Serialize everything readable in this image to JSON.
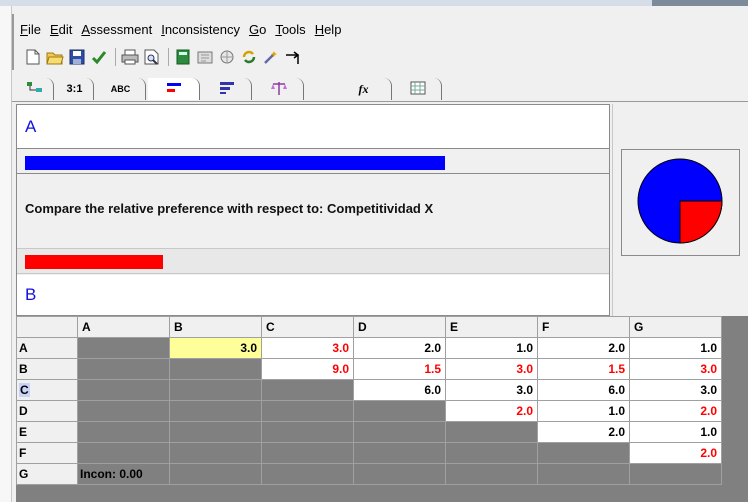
{
  "menu": [
    "File",
    "Edit",
    "Assessment",
    "Inconsistency",
    "Go",
    "Tools",
    "Help"
  ],
  "menu_underline": [
    "F",
    "E",
    "A",
    "I",
    "G",
    "T",
    "H"
  ],
  "toolbar_icons": [
    "new-icon",
    "open-icon",
    "save-icon",
    "check-icon",
    "print-icon",
    "print-preview-icon",
    "calculator-icon",
    "sheet-icon",
    "sensitivity-icon",
    "refresh-icon",
    "wand-icon",
    "arrow-right-icon"
  ],
  "tabs": [
    {
      "icon": "tree-icon",
      "label": ""
    },
    {
      "icon": "ratio-icon",
      "label": "3:1"
    },
    {
      "icon": "abc-icon",
      "label": "ABC"
    },
    {
      "icon": "bars-icon",
      "label": ""
    },
    {
      "icon": "bars-blue-icon",
      "label": ""
    },
    {
      "icon": "scale-icon",
      "label": ""
    },
    {
      "icon": "formula-icon",
      "label": "fx"
    },
    {
      "icon": "grid-icon",
      "label": ""
    }
  ],
  "compare": {
    "item_a": "A",
    "item_b": "B",
    "question": "Compare the relative preference with respect to: Competitividad X",
    "bar_a_fraction": 0.73,
    "bar_b_fraction": 0.24,
    "bar_a_color": "#0000ff",
    "bar_b_color": "#ff0000"
  },
  "pie": {
    "blue_fraction": 0.75,
    "red_fraction": 0.25,
    "colors": [
      "#0000ff",
      "#ff0000"
    ]
  },
  "matrix": {
    "columns": [
      "A",
      "B",
      "C",
      "D",
      "E",
      "F",
      "G"
    ],
    "rows": [
      {
        "label": "A",
        "cells": [
          null,
          {
            "v": "3.0",
            "c": "y"
          },
          {
            "v": "3.0",
            "c": "red"
          },
          {
            "v": "2.0",
            "c": "blk"
          },
          {
            "v": "1.0",
            "c": "blk"
          },
          {
            "v": "2.0",
            "c": "blk"
          },
          {
            "v": "1.0",
            "c": "blk"
          }
        ]
      },
      {
        "label": "B",
        "cells": [
          null,
          null,
          {
            "v": "9.0",
            "c": "red"
          },
          {
            "v": "1.5",
            "c": "red"
          },
          {
            "v": "3.0",
            "c": "red"
          },
          {
            "v": "1.5",
            "c": "red"
          },
          {
            "v": "3.0",
            "c": "red"
          }
        ]
      },
      {
        "label": "C",
        "cells": [
          null,
          null,
          null,
          {
            "v": "6.0",
            "c": "blk"
          },
          {
            "v": "3.0",
            "c": "blk"
          },
          {
            "v": "6.0",
            "c": "blk"
          },
          {
            "v": "3.0",
            "c": "blk"
          }
        ]
      },
      {
        "label": "D",
        "cells": [
          null,
          null,
          null,
          null,
          {
            "v": "2.0",
            "c": "red"
          },
          {
            "v": "1.0",
            "c": "blk"
          },
          {
            "v": "2.0",
            "c": "red"
          }
        ]
      },
      {
        "label": "E",
        "cells": [
          null,
          null,
          null,
          null,
          null,
          {
            "v": "2.0",
            "c": "blk"
          },
          {
            "v": "1.0",
            "c": "blk"
          }
        ]
      },
      {
        "label": "F",
        "cells": [
          null,
          null,
          null,
          null,
          null,
          null,
          {
            "v": "2.0",
            "c": "red"
          }
        ]
      },
      {
        "label": "G",
        "cells": [
          null,
          null,
          null,
          null,
          null,
          null,
          null
        ]
      }
    ],
    "inconsistency": "Incon: 0.00"
  }
}
